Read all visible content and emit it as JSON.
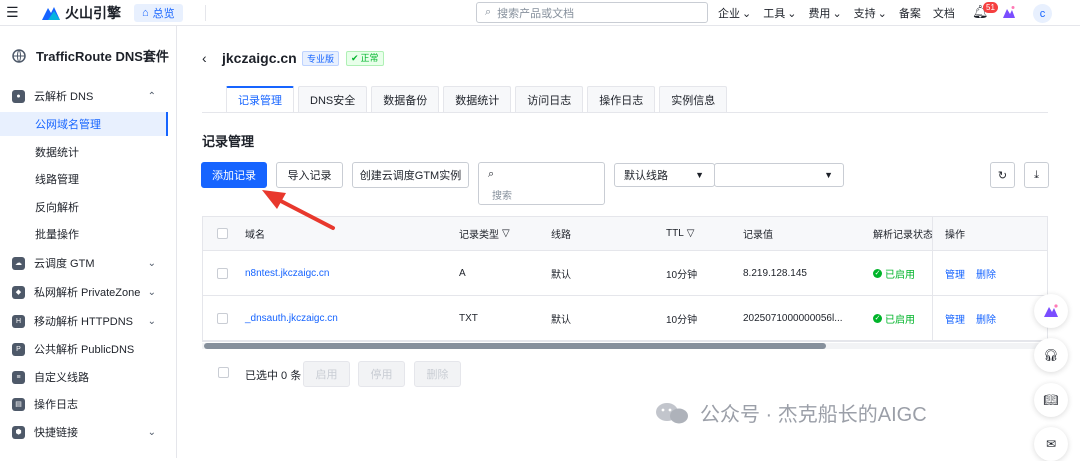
{
  "topbar": {
    "logo_text": "火山引擎",
    "home_label": "总览",
    "search_placeholder": "搜索产品或文档",
    "nav": [
      "企业",
      "工具",
      "费用",
      "支持",
      "备案",
      "文档"
    ],
    "notifications": "51",
    "avatar": "c"
  },
  "sidebar": {
    "title": "TrafficRoute DNS套件",
    "groups": [
      {
        "label": "云解析 DNS",
        "chevron": "up"
      },
      {
        "label": "云调度 GTM",
        "chevron": "down"
      },
      {
        "label": "私网解析 PrivateZone",
        "chevron": "down"
      },
      {
        "label": "移动解析 HTTPDNS",
        "chevron": "down"
      },
      {
        "label": "公共解析 PublicDNS"
      },
      {
        "label": "自定义线路"
      },
      {
        "label": "操作日志"
      },
      {
        "label": "快捷链接",
        "chevron": "down"
      }
    ],
    "sub_items": [
      "公网域名管理",
      "数据统计",
      "线路管理",
      "反向解析",
      "批量操作"
    ]
  },
  "header": {
    "domain": "jkczaigc.cn",
    "edition_tag": "专业版",
    "status_tag": "正常"
  },
  "tabs": [
    "记录管理",
    "DNS安全",
    "数据备份",
    "数据统计",
    "访问日志",
    "操作日志",
    "实例信息"
  ],
  "section_title": "记录管理",
  "toolbar": {
    "add": "添加记录",
    "import": "导入记录",
    "create_gtm": "创建云调度GTM实例",
    "search_placeholder": "搜索",
    "line_select": "默认线路"
  },
  "table": {
    "columns": [
      "域名",
      "记录类型",
      "线路",
      "TTL",
      "记录值",
      "解析记录状态",
      "操作"
    ],
    "rows": [
      {
        "domain": "n8ntest.jkczaigc.cn",
        "type": "A",
        "line": "默认",
        "ttl": "10分钟",
        "value": "8.219.128.145",
        "status": "已启用",
        "manage": "管理",
        "delete": "删除"
      },
      {
        "domain": "_dnsauth.jkczaigc.cn",
        "type": "TXT",
        "line": "默认",
        "ttl": "10分钟",
        "value": "2025071000000056l...",
        "status": "已启用",
        "manage": "管理",
        "delete": "删除"
      }
    ]
  },
  "footer": {
    "selected": "已选中 0 条",
    "enable": "启用",
    "disable": "停用",
    "delete": "删除"
  },
  "watermark": "公众号 · 杰克船长的AIGC",
  "colors": {
    "accent": "#1664ff",
    "success": "#00b42a",
    "annotation_arrow": "#e8382d"
  }
}
